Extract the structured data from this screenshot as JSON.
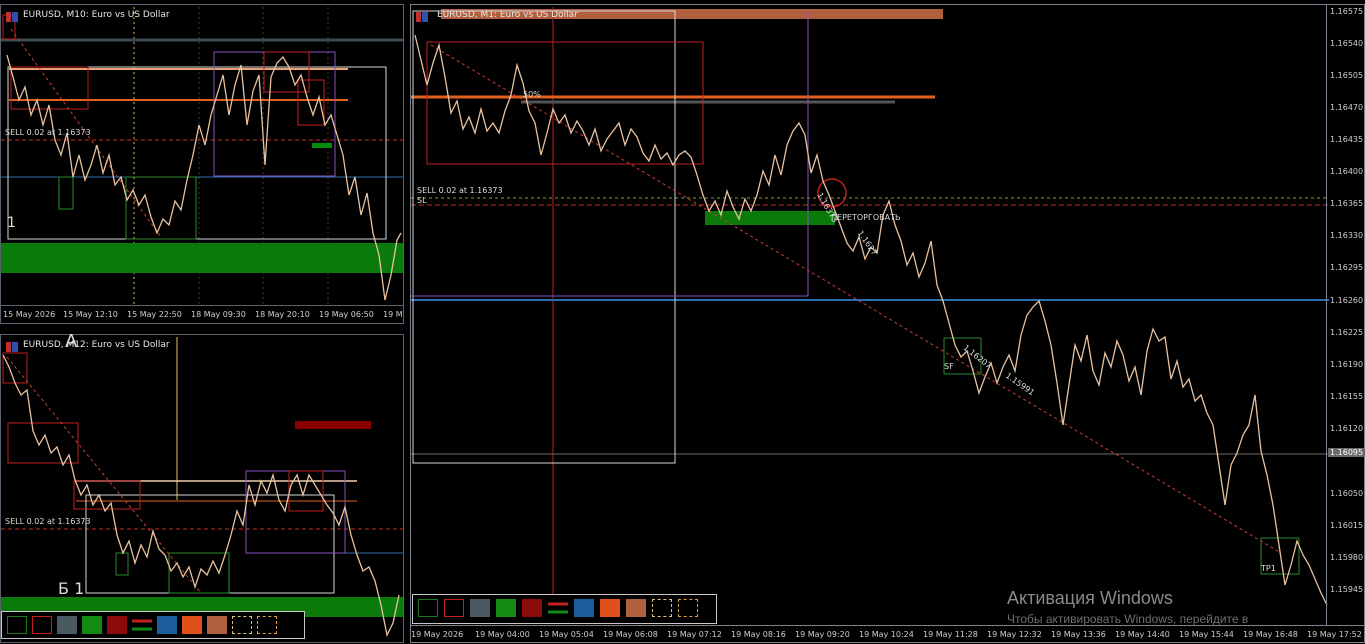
{
  "windows": {
    "m10": {
      "title": "EURUSD, M10:  Euro vs US Dollar",
      "sell_label": "SELL 0.02 at 1.16373",
      "mark_label": "1",
      "time_ticks": [
        "15 May 2026",
        "15 May 12:10",
        "15 May 22:50",
        "18 May 09:30",
        "18 May 20:10",
        "19 May 06:50",
        "19 M"
      ]
    },
    "m12": {
      "title": "EURUSD, M12:  Euro vs US Dollar",
      "sell_label": "SELL 0.02 at 1.16373",
      "mark_label_a": "A",
      "mark_label_b": "Б 1"
    },
    "m1": {
      "title": "EURUSD, M1:  Euro vs US Dollar",
      "sell_label": "SELL 0.02 at 1.16373",
      "sl_label": "SL",
      "fifty_label": "50%",
      "zone_label": "ПЕРЕТОРГОВАТЬ",
      "sf_label": "SF",
      "tp_label": "TP1",
      "trend_label_1": "1.16373",
      "trend_label_2": "1.16207",
      "trend_label_3": "1.15991",
      "trend_label_4": "1.1627",
      "current_price": "1.16095",
      "price_ticks": [
        "1.16575",
        "1.16540",
        "1.16505",
        "1.16470",
        "1.16435",
        "1.16400",
        "1.16365",
        "1.16330",
        "1.16295",
        "1.16260",
        "1.16225",
        "1.16190",
        "1.16155",
        "1.16120",
        "1.16085",
        "1.16050",
        "1.16015",
        "1.15980",
        "1.15945"
      ],
      "time_ticks": [
        "19 May 2026",
        "19 May 04:00",
        "19 May 05:04",
        "19 May 06:08",
        "19 May 07:12",
        "19 May 08:16",
        "19 May 09:20",
        "19 May 10:24",
        "19 May 11:28",
        "19 May 12:32",
        "19 May 13:36",
        "19 May 14:40",
        "19 May 15:44",
        "19 May 16:48",
        "19 May 17:52"
      ]
    }
  },
  "toolbar_colors": {
    "green": "#1a7a1a",
    "red": "#c0201e",
    "slate": "#4a5a62",
    "dkgreen": "#138a13",
    "maroon": "#8b0a0a",
    "blue": "#1b5d9a",
    "orange": "#e0501a",
    "brown": "#b0603e"
  },
  "activation": {
    "line1": "Активация Windows",
    "line2": "Чтобы активировать Windows, перейдите в"
  }
}
